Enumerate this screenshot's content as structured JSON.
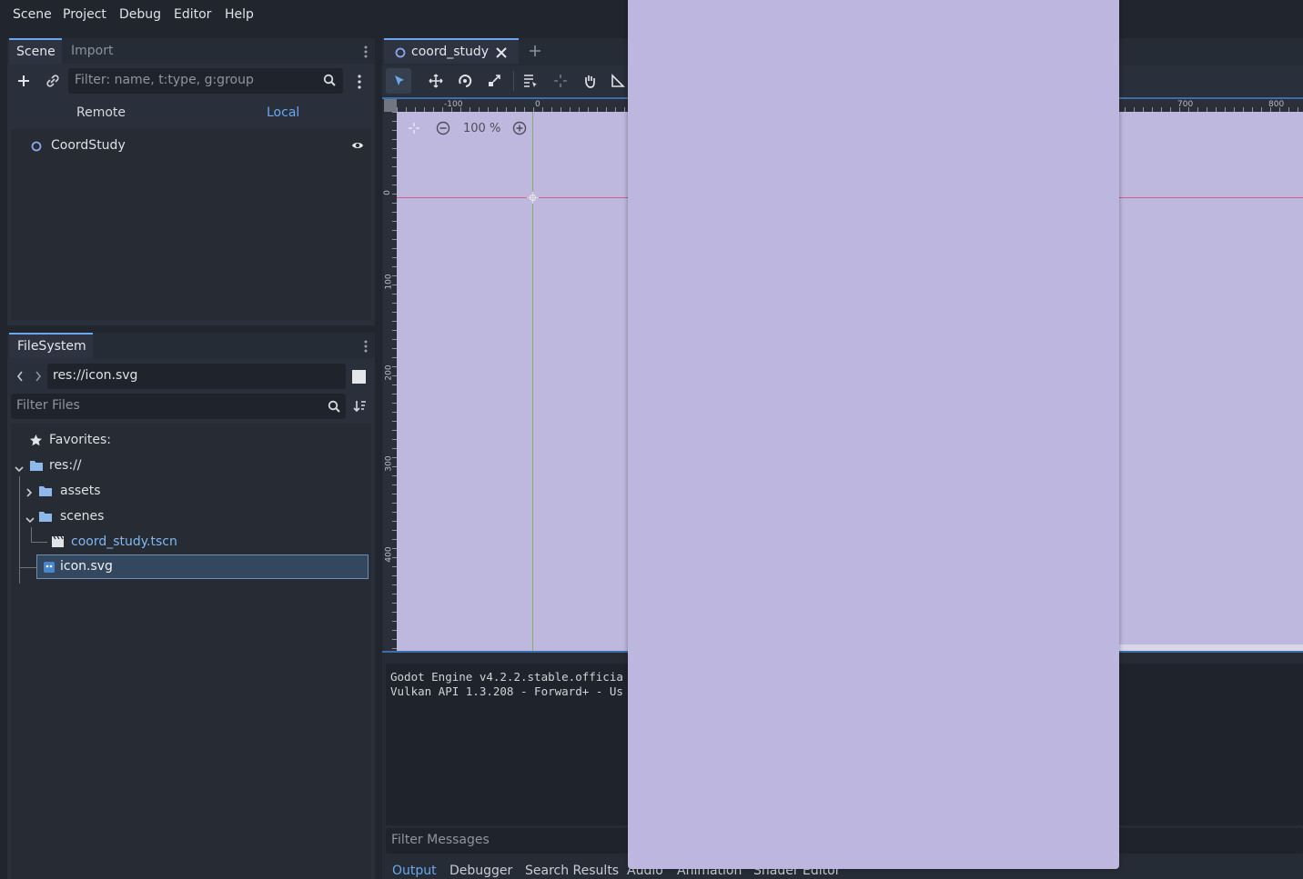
{
  "menu": {
    "items": [
      "Scene",
      "Project",
      "Debug",
      "Editor",
      "Help"
    ]
  },
  "scene_dock": {
    "tabs": [
      "Scene",
      "Import"
    ],
    "filter_placeholder": "Filter: name, t:type, g:group",
    "remote_label": "Remote",
    "local_label": "Local",
    "root_node": "CoordStudy"
  },
  "filesystem": {
    "tab": "FileSystem",
    "path": "res://icon.svg",
    "filter_placeholder": "Filter Files",
    "favorites": "Favorites:",
    "tree": [
      {
        "label": "res://"
      },
      {
        "label": "assets"
      },
      {
        "label": "scenes"
      },
      {
        "label": "coord_study.tscn"
      },
      {
        "label": "icon.svg"
      }
    ]
  },
  "editor": {
    "scene_tab": "coord_study",
    "zoom": "100 %",
    "ruler_h_ticks": [
      "-100",
      "0",
      "700",
      "800"
    ],
    "ruler_v_ticks": [
      "0",
      "100",
      "200",
      "300",
      "400"
    ]
  },
  "output": {
    "lines": [
      "Godot Engine v4.2.2.stable.officia",
      "Vulkan API 1.3.208 - Forward+ - Us"
    ],
    "filter_placeholder": "Filter Messages"
  },
  "bottom_tabs": [
    "Output",
    "Debugger",
    "Search Results",
    "Audio",
    "Animation",
    "Shader Editor"
  ],
  "colors": {
    "accent": "#6aa7ee",
    "canvas": "#bfb8de",
    "overlay": "#bdb6de",
    "selection": "#33475e"
  }
}
